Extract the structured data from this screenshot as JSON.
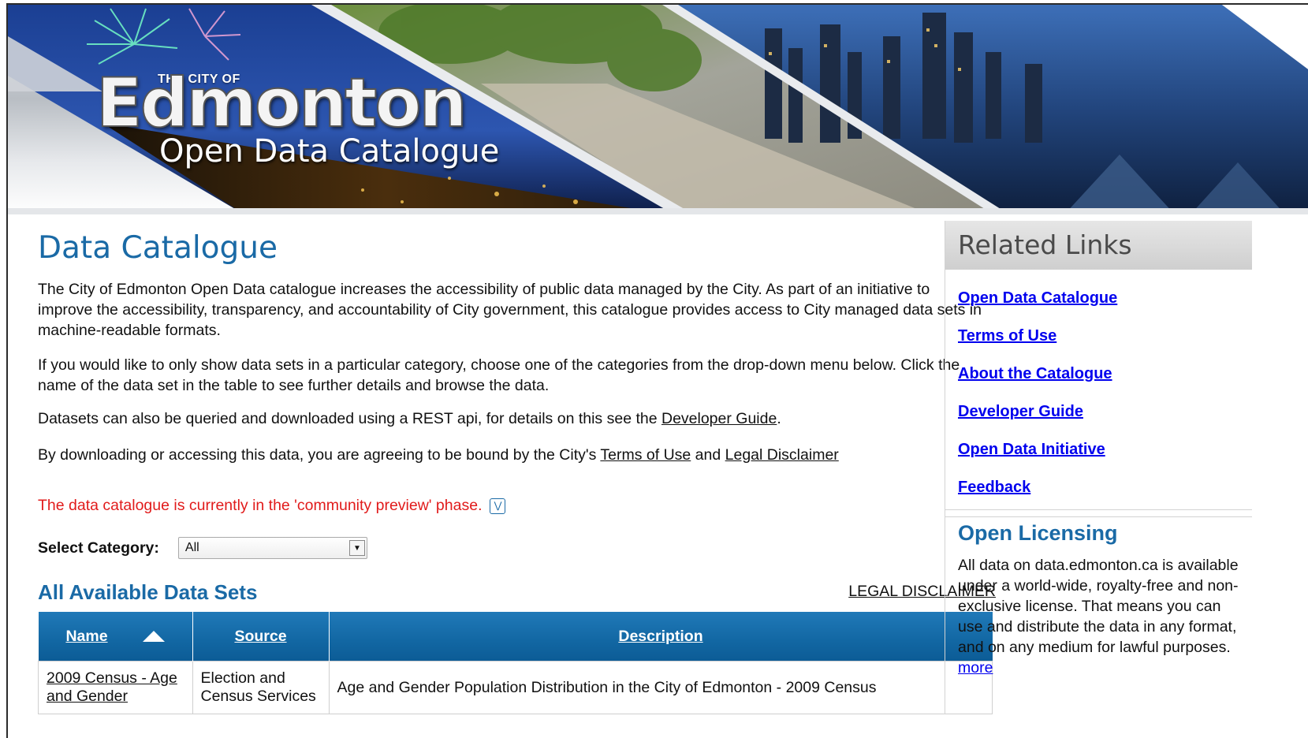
{
  "banner": {
    "logo_small": "THE CITY OF",
    "logo_big": "Edmonton",
    "logo_sub": "Open Data Catalogue"
  },
  "main": {
    "title": "Data Catalogue",
    "intro": "The City of Edmonton Open Data catalogue increases the accessibility of public data managed by the City. As part of an initiative to improve the accessibility, transparency, and accountability of City government, this catalogue provides access to City managed data sets in machine-readable formats.",
    "category_help": "If you would like to only show data sets in a particular category, choose one of the categories from the drop-down menu below. Click the name of the data set in the table to see further details and browse the data.",
    "api_text": "Datasets can also be queried and downloaded using a REST api, for details on this see the ",
    "api_link": "Developer Guide",
    "api_end": ".",
    "terms_text": "By downloading or accessing this data, you are agreeing to be bound by the City's ",
    "terms_link": "Terms of Use",
    "terms_and": " and ",
    "disclaimer_link": "Legal Disclaimer",
    "preview_notice": "The data catalogue is currently in the 'community preview' phase.",
    "select_label": "Select Category:",
    "select_value": "All",
    "sets_title": "All Available Data Sets",
    "legal_disclaimer": "LEGAL DISCLAIMER"
  },
  "table": {
    "headers": {
      "name": "Name",
      "source": "Source",
      "description": "Description"
    },
    "rows": [
      {
        "name": "2009 Census - Age and Gender",
        "source": "Election and Census Services",
        "description": "Age and Gender Population Distribution in the City of Edmonton - 2009 Census"
      }
    ]
  },
  "sidebar": {
    "related_title": "Related Links",
    "links": [
      "Open Data Catalogue",
      "Terms of Use",
      "About the Catalogue",
      "Developer Guide",
      "Open Data Initiative",
      "Feedback"
    ],
    "licensing_title": "Open Licensing",
    "licensing_text": "All data on data.edmonton.ca is available under a world-wide, royalty-free and non-exclusive license. That means you can use and distribute the data in any format, and on any medium for lawful purposes. ",
    "licensing_more": "more"
  },
  "colors": {
    "accent_blue": "#1a6aa6",
    "notice_red": "#e11b1b",
    "table_header": "#1267a3"
  }
}
